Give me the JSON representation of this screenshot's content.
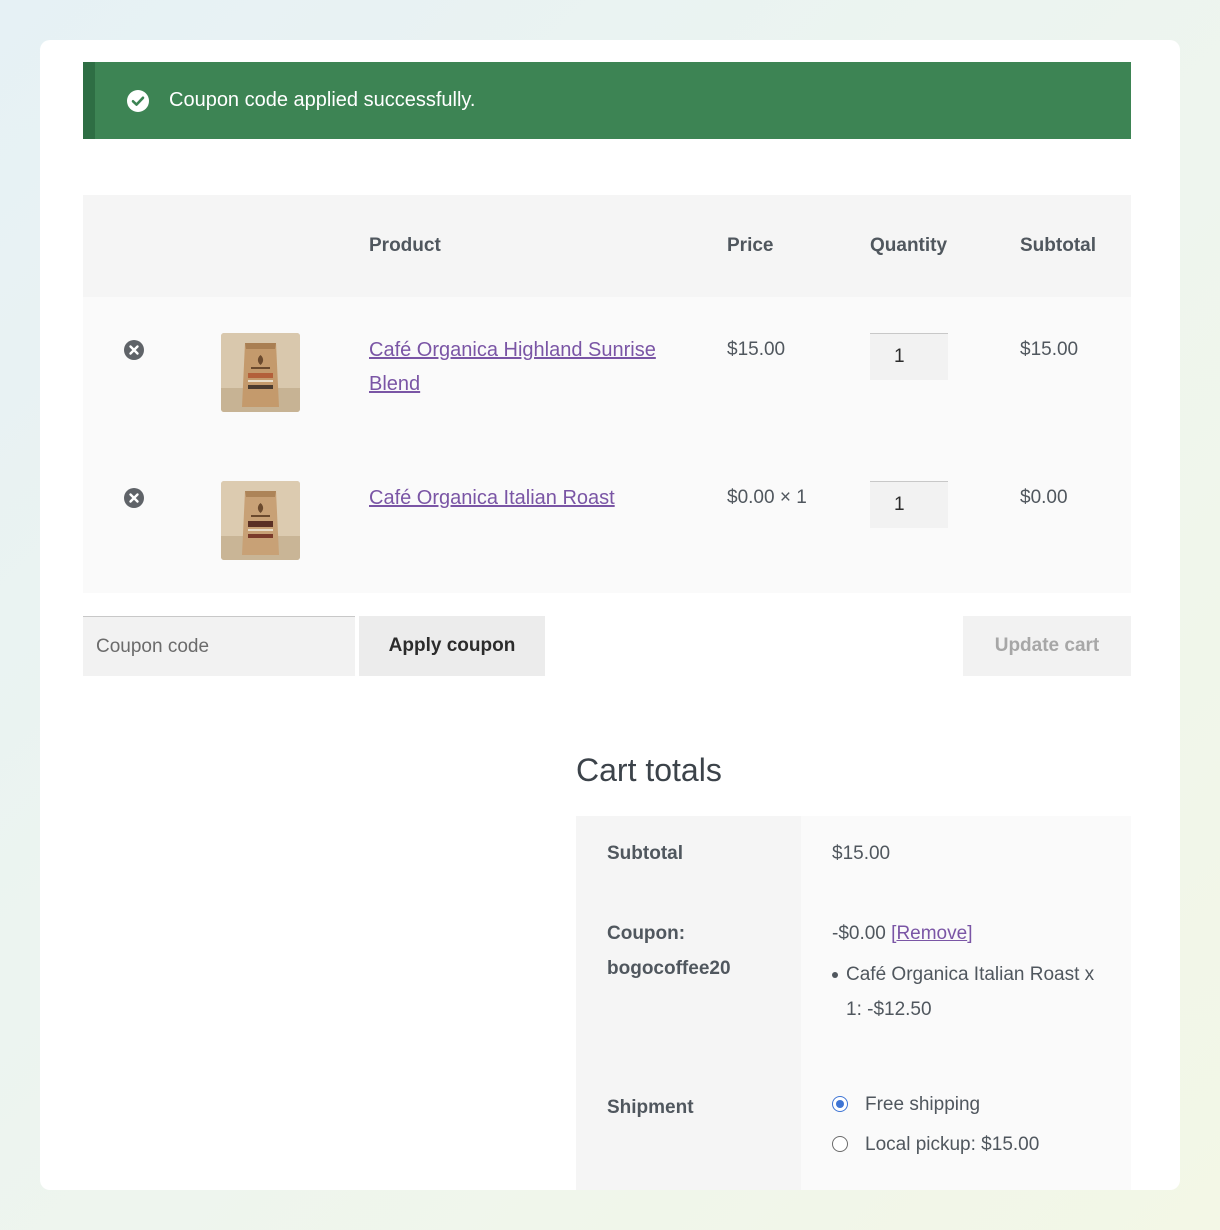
{
  "notice": {
    "message": "Coupon code applied successfully.",
    "icon": "check-circle-icon",
    "color": "#3d8454"
  },
  "cart": {
    "headers": {
      "product": "Product",
      "price": "Price",
      "quantity": "Quantity",
      "subtotal": "Subtotal"
    },
    "items": [
      {
        "name": "Café Organica Highland Sunrise Blend",
        "price": "$15.00",
        "quantity": "1",
        "subtotal": "$15.00"
      },
      {
        "name": "Café Organica Italian Roast",
        "price": "$0.00 × 1",
        "quantity": "1",
        "subtotal": "$0.00"
      }
    ]
  },
  "actions": {
    "coupon_placeholder": "Coupon code",
    "apply_label": "Apply coupon",
    "update_label": "Update cart"
  },
  "totals": {
    "title": "Cart totals",
    "subtotal_label": "Subtotal",
    "subtotal_value": "$15.00",
    "coupon_label": "Coupon: bogocoffee20",
    "coupon_amount": "-$0.00",
    "remove_label": "Remove",
    "coupon_detail": "Café Organica Italian Roast x 1: -$12.50",
    "shipment_label": "Shipment",
    "shipping_options": [
      {
        "label": "Free shipping",
        "selected": true
      },
      {
        "label": "Local pickup: $15.00",
        "selected": false
      }
    ]
  },
  "colors": {
    "link": "#7a55a5",
    "accent_radio": "#3f75d4"
  }
}
